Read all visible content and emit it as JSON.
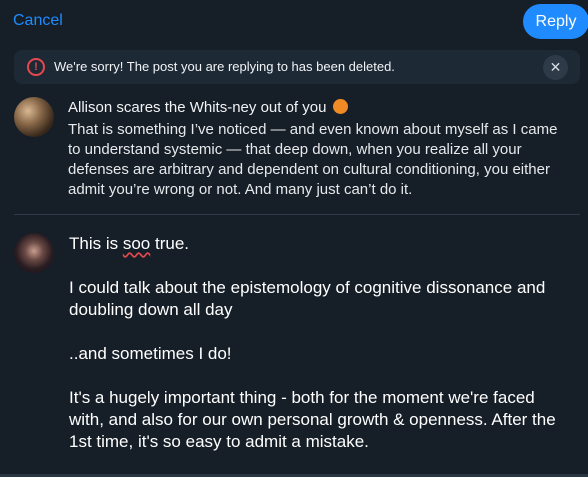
{
  "header": {
    "cancel_label": "Cancel",
    "reply_label": "Reply"
  },
  "notice": {
    "icon": "exclamation-circle-icon",
    "text": "We're sorry! The post you are replying to has been deleted.",
    "close_glyph": "✕"
  },
  "parent_post": {
    "author": "Allison scares the Whits-ney out of you",
    "author_emoji": "pumpkin-icon",
    "text": "That is something I’ve noticed — and even known about myself as I came to understand systemic — that deep down, when you realize all your defenses are arbitrary and dependent on cultural conditioning, you either admit you’re wrong or not. And many just can’t do it."
  },
  "composer": {
    "para1_before": "This is ",
    "para1_misspelled": "soo",
    "para1_after": " true.",
    "para2": "I could talk about the epistemology of cognitive dissonance and doubling down all day",
    "para3": "..and sometimes I do!",
    "para4": "It's a hugely important thing - both for the moment we're faced with, and also for our own personal growth & openness. After the 1st time, it's so easy to admit a mistake."
  },
  "colors": {
    "accent": "#208bfe",
    "background": "#161e27",
    "notice_bg": "#1e2936",
    "error": "#e5484d"
  }
}
